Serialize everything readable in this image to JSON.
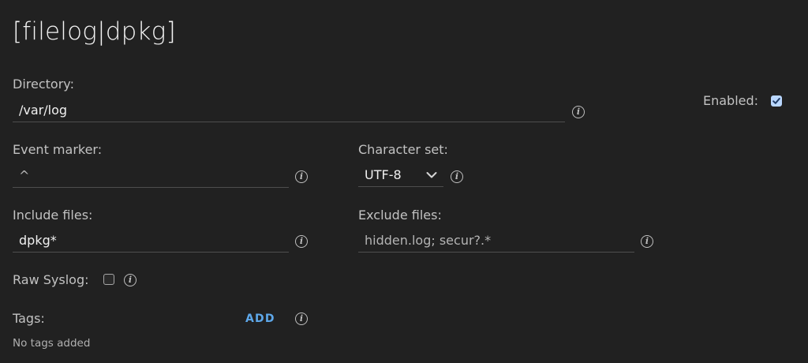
{
  "header": {
    "title": "[filelog|dpkg]"
  },
  "directory": {
    "label": "Directory:",
    "value": "/var/log"
  },
  "enabled": {
    "label": "Enabled:",
    "checked": true
  },
  "event_marker": {
    "label": "Event marker:",
    "value": "^"
  },
  "charset": {
    "label": "Character set:",
    "value": "UTF-8"
  },
  "include_files": {
    "label": "Include files:",
    "value": "dpkg*"
  },
  "exclude_files": {
    "label": "Exclude files:",
    "value": "hidden.log; secur?.*"
  },
  "raw_syslog": {
    "label": "Raw Syslog:",
    "checked": false
  },
  "tags": {
    "label": "Tags:",
    "add_label": "ADD",
    "empty_text": "No tags added"
  },
  "icons": {
    "info": "info-icon",
    "chevron": "chevron-down-icon",
    "check": "check-icon"
  },
  "colors": {
    "background": "#212121",
    "accent": "#5ea8ea",
    "checkbox_checked": "#b9d7ff"
  }
}
